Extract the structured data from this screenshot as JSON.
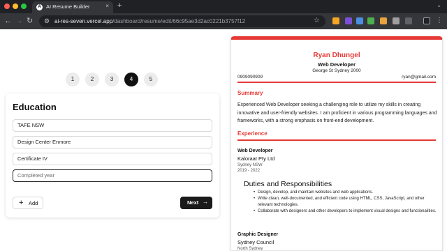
{
  "browser": {
    "tab_title": "AI Resume Builder",
    "tab_favicon": "A",
    "tab_close": "×",
    "new_tab": "+",
    "url_host": "ai-res-seven.vercel.app",
    "url_path": "/dashboard/resume/edit/66c95ae3d2ac0221b3757f12",
    "icons": [
      "back-arrow-icon",
      "forward-arrow-icon",
      "reload-icon",
      "site-info-icon",
      "star-icon",
      "extension-icons"
    ]
  },
  "stepper": {
    "steps": [
      "1",
      "2",
      "3",
      "4",
      "5"
    ],
    "active_step": "4"
  },
  "form": {
    "title": "Education",
    "fields": {
      "university": "TAFE NSW",
      "degree": "Design Center Enmore",
      "major": "Certificate IV",
      "year_placeholder": "Completed year"
    },
    "add_label": "Add",
    "next_label": "Next"
  },
  "resume": {
    "accent_color": "#e53935",
    "name": "Ryan Dhungel",
    "job_title": "Web Developer",
    "address": "George St Sydney 2000",
    "phone": "0909090909",
    "email": "ryan@gmail.com",
    "summary_heading": "Summary",
    "summary": "Experienced Web Developer seeking a challenging role to utilize my skills in creating innovative and user-friendly websites. I am proficient in various programming languages and frameworks, with a strong emphasis on front-end development.",
    "experience_heading": "Experience",
    "experience": [
      {
        "title": "Web Developer",
        "company": "Kaloraat Pty Ltd",
        "location": "Sydney NSW",
        "dates": "2019 - 2022",
        "duties_heading": "Duties and Responsibilities",
        "duties": [
          "Design, develop, and maintain websites and web applications.",
          "Write clean, well-documented, and efficient code using HTML, CSS, JavaScript, and other relevant technologies.",
          "Collaborate with designers and other developers to implement visual designs and functionalities."
        ]
      },
      {
        "title": "Graphic Designer",
        "company": "Sydney Council",
        "location": "North Sydney"
      }
    ]
  }
}
